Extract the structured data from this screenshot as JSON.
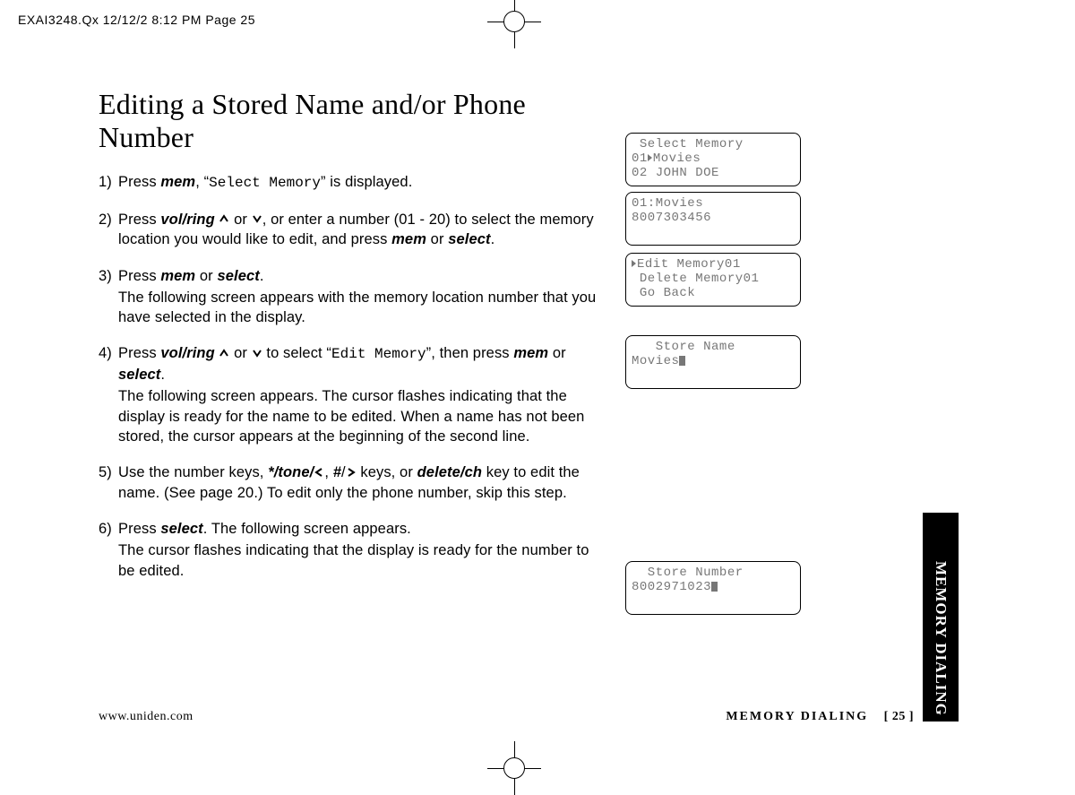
{
  "printer_header": "EXAI3248.Qx  12/12/2  8:12 PM  Page 25",
  "title": "Editing a Stored Name and/or Phone Number",
  "steps": {
    "s1": {
      "num": "1)",
      "t1": "Press ",
      "mem": "mem",
      "t2": ", “",
      "mono1": "Select Memory",
      "t3": "” is displayed."
    },
    "s2": {
      "num": "2)",
      "t1": "Press ",
      "volring": "vol/ring",
      "t2": " or ",
      "t3": ", or enter a number (01 - 20) to select the memory location you would like to edit, and press ",
      "mem": "mem",
      "or": " or ",
      "select": "select",
      "dot": "."
    },
    "s3": {
      "num": "3)",
      "t1": "Press ",
      "mem": "mem",
      "or": " or ",
      "select": "select",
      "dot": ".",
      "para": "The following screen appears with the memory location number that you have selected in the display."
    },
    "s4": {
      "num": "4)",
      "t1": "Press ",
      "volring": "vol/ring",
      "t2": " or ",
      "t3": " to select “",
      "mono1": "Edit Memory",
      "t4": "”, then press ",
      "mem": "mem",
      "or": " or ",
      "select": "select",
      "dot": ".",
      "para": "The following screen appears. The cursor flashes indicating that the display is ready for the name to be edited. When a name has not been stored, the cursor appears at the beginning of the second line."
    },
    "s5": {
      "num": "5)",
      "t1": "Use the number keys, ",
      "star": "*",
      "tone": "/tone/",
      "comma": ", ",
      "hash": "#",
      "slash": "/",
      "t2": " keys, or ",
      "del": "delete/ch",
      "t3": " key to edit the name. (See page 20.) To edit only the phone number, skip this step."
    },
    "s6": {
      "num": "6)",
      "t1": "Press ",
      "select": "select",
      "t2": ". The following screen appears.",
      "para": "The cursor flashes indicating that the display is ready for the number to be edited."
    }
  },
  "lcd1": {
    "l1": " Select Memory",
    "l2a": "01",
    "l2b": "Movies",
    "l3": "02 JOHN DOE"
  },
  "lcd2": {
    "l1": "01:Movies",
    "l2": "8007303456"
  },
  "lcd3": {
    "l1": "Edit Memory01",
    "l2": " Delete Memory01",
    "l3": " Go Back"
  },
  "lcd4": {
    "l1": "   Store Name",
    "l2": "Movies"
  },
  "lcd5": {
    "l1": "  Store Number",
    "l2": "8002971023"
  },
  "sidetab": "MEMORY DIALING",
  "footer": {
    "left": "www.uniden.com",
    "right_label": "MEMORY DIALING",
    "page": "[ 25 ]"
  }
}
